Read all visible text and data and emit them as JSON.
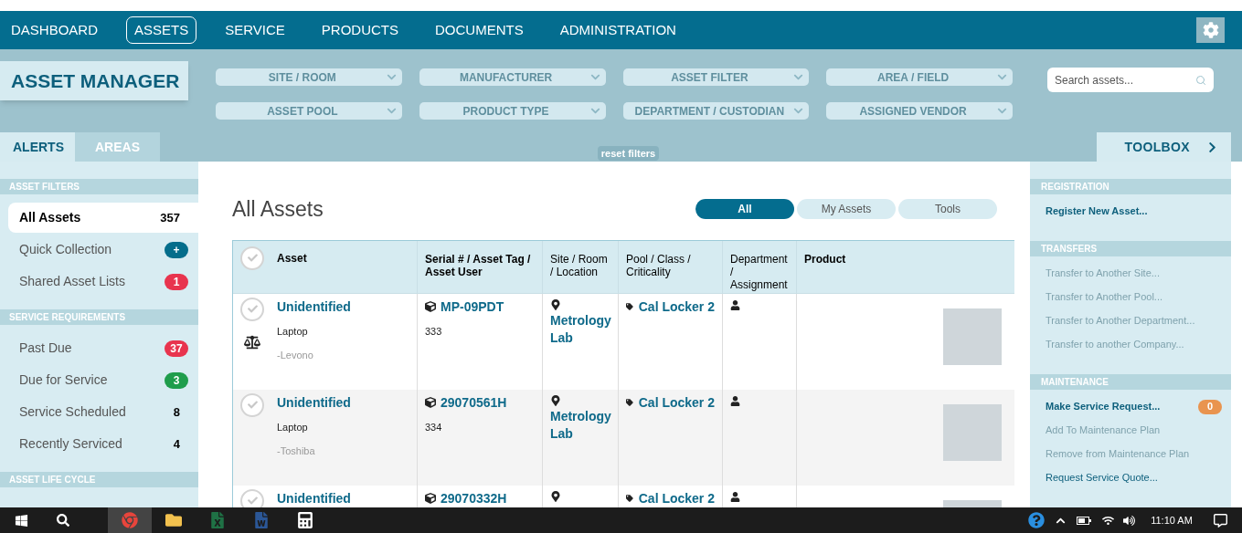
{
  "nav": {
    "items": [
      {
        "label": "DASHBOARD",
        "selected": false
      },
      {
        "label": "ASSETS",
        "selected": true
      },
      {
        "label": "SERVICE",
        "selected": false
      },
      {
        "label": "PRODUCTS",
        "selected": false
      },
      {
        "label": "DOCUMENTS",
        "selected": false
      },
      {
        "label": "ADMINISTRATION",
        "selected": false
      }
    ]
  },
  "header": {
    "title": "ASSET MANAGER",
    "filters": [
      {
        "label": "SITE / ROOM"
      },
      {
        "label": "MANUFACTURER"
      },
      {
        "label": "ASSET FILTER"
      },
      {
        "label": "AREA / FIELD"
      },
      {
        "label": "ASSET POOL"
      },
      {
        "label": "PRODUCT TYPE"
      },
      {
        "label": "DEPARTMENT / CUSTODIAN"
      },
      {
        "label": "ASSIGNED VENDOR"
      }
    ],
    "search": {
      "placeholder": "Search assets..."
    },
    "reset": "reset filters"
  },
  "left_tabs": [
    {
      "label": "ALERTS",
      "selected": true
    },
    {
      "label": "AREAS",
      "selected": false
    }
  ],
  "toolbox": {
    "label": "TOOLBOX"
  },
  "sidebar": {
    "sections": [
      {
        "title": "ASSET FILTERS",
        "items": [
          {
            "label": "All Assets",
            "count": "357",
            "selected": true
          },
          {
            "label": "Quick Collection",
            "count": "+",
            "selected": false,
            "color": "#046d8b"
          },
          {
            "label": "Shared Asset Lists",
            "count": "1",
            "selected": false,
            "color": "#e8344e"
          }
        ]
      },
      {
        "title": "SERVICE REQUIREMENTS",
        "items": [
          {
            "label": "Past Due",
            "count": "37",
            "selected": false,
            "color": "#e8344e"
          },
          {
            "label": "Due for Service",
            "count": "3",
            "selected": false,
            "color": "#1f9d4c"
          },
          {
            "label": "Service Scheduled",
            "count": "8",
            "selected": false
          },
          {
            "label": "Recently Serviced",
            "count": "4",
            "selected": false
          }
        ]
      },
      {
        "title": "ASSET LIFE CYCLE"
      }
    ]
  },
  "main": {
    "title": "All Assets",
    "view_tabs": [
      {
        "label": "All",
        "selected": true
      },
      {
        "label": "My Assets",
        "selected": false
      },
      {
        "label": "Tools",
        "selected": false
      }
    ],
    "table": {
      "all_selected": false,
      "columns": [
        {
          "label": "Asset",
          "bold": true
        },
        {
          "label": "Serial # / Asset Tag / Asset User",
          "bold": true
        },
        {
          "label": "Site / Room / Location",
          "bold": false
        },
        {
          "label": "Pool / Class / Criticality",
          "bold": false
        },
        {
          "label": "Department / Assignment",
          "bold": false
        },
        {
          "label": "Product",
          "bold": true
        }
      ],
      "rows": [
        {
          "selected": false,
          "name": "Unidentified",
          "type": "Laptop",
          "maker": "-Levono",
          "scale": true,
          "serial": "MP-09PDT",
          "tag": "333",
          "site": "Metrology Lab",
          "pool": "Cal Locker 2"
        },
        {
          "selected": false,
          "name": "Unidentified",
          "type": "Laptop",
          "maker": "-Toshiba",
          "scale": false,
          "serial": "29070561H",
          "tag": "334",
          "site": "Metrology Lab",
          "pool": "Cal Locker 2"
        },
        {
          "selected": false,
          "name": "Unidentified",
          "serial": "29070332H",
          "pool": "Cal Locker 2"
        }
      ]
    }
  },
  "right_panel": {
    "sections": [
      {
        "title": "REGISTRATION",
        "items": [
          {
            "label": "Register New Asset...",
            "bold": true,
            "disabled": false
          }
        ]
      },
      {
        "title": "TRANSFERS",
        "items": [
          {
            "label": "Transfer to Another Site...",
            "bold": false,
            "disabled": true
          },
          {
            "label": "Transfer to Another Pool...",
            "bold": false,
            "disabled": true
          },
          {
            "label": "Transfer to Another Department...",
            "bold": false,
            "disabled": true
          },
          {
            "label": "Transfer to another Company...",
            "bold": false,
            "disabled": true
          }
        ]
      },
      {
        "title": "MAINTENANCE",
        "items": [
          {
            "label": "Make Service Request...",
            "bold": true,
            "disabled": false,
            "count": "0"
          },
          {
            "label": "Add To Maintenance Plan",
            "bold": false,
            "disabled": true
          },
          {
            "label": "Remove from Maintenance Plan",
            "bold": false,
            "disabled": true
          },
          {
            "label": "Request Service Quote...",
            "bold": false,
            "disabled": false
          }
        ]
      }
    ]
  },
  "taskbar": {
    "apps": [
      {
        "kind": "chrome",
        "selected": true
      },
      {
        "kind": "folder",
        "selected": false
      },
      {
        "kind": "excel",
        "selected": false
      },
      {
        "kind": "word",
        "selected": false
      },
      {
        "kind": "calculator",
        "selected": false
      }
    ],
    "time": "11:10 AM"
  }
}
